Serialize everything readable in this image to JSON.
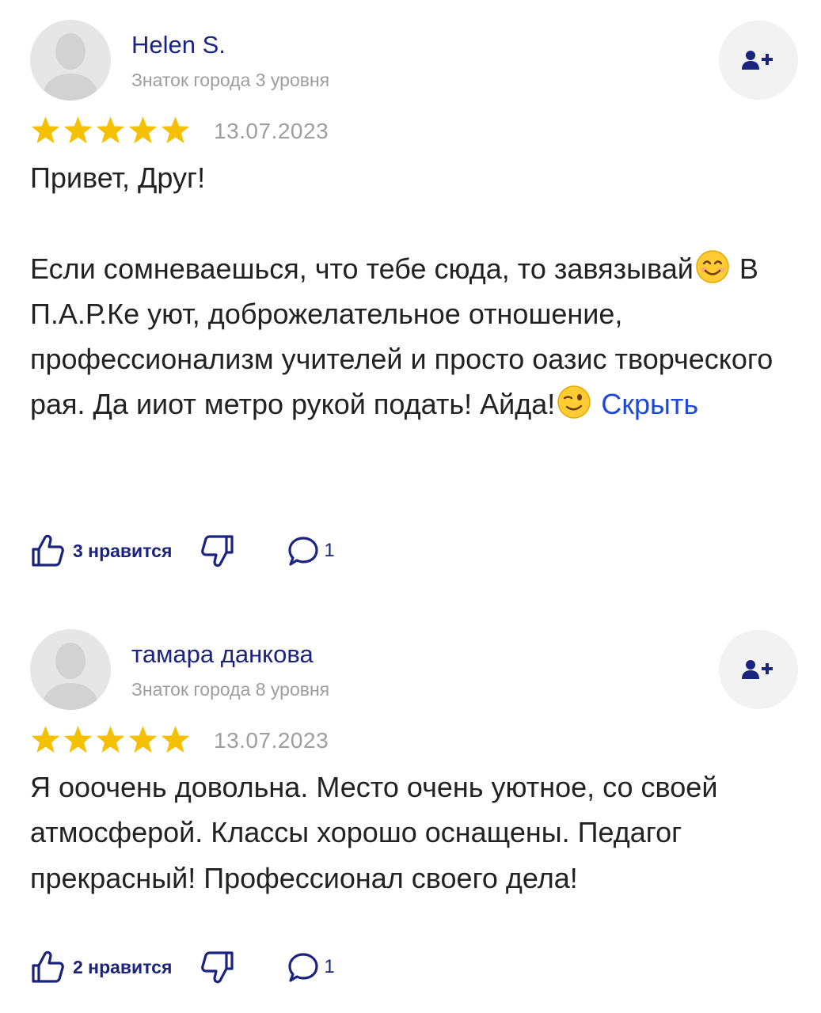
{
  "colors": {
    "name_blue": "#1a237e",
    "meta_gray": "#9e9e9e",
    "star_gold": "#f5c000",
    "link_blue": "#1e4bd6",
    "button_bg": "#f2f2f2"
  },
  "reviews": [
    {
      "author": "Helen S.",
      "level": "Знаток города 3 уровня",
      "rating": 5,
      "date": "13.07.2023",
      "text_part1": "Привет, Друг!\n\nЕсли сомневаешься, что тебе сюда, то завязывай",
      "emoji1": "smiling-face-emoji",
      "text_part2": " В П.А.Р.Ке уют, доброжелательное отношение, профессионализм учителей и просто оазис творческого рая. Да ииот метро рукой подать! Айда!",
      "emoji2": "winking-face-emoji",
      "hide_label": "Скрыть",
      "likes_label": "3 нравится",
      "comments": "1"
    },
    {
      "author": "тамара данкова",
      "level": "Знаток города 8 уровня",
      "rating": 5,
      "date": "13.07.2023",
      "text": "Я ooочень довольна. Место очень уютное, со своей атмосферой. Классы хорошо оснащены. Педагог прекрасный! Профессионал своего дела!",
      "likes_label": "2 нравится",
      "comments": "1"
    }
  ]
}
